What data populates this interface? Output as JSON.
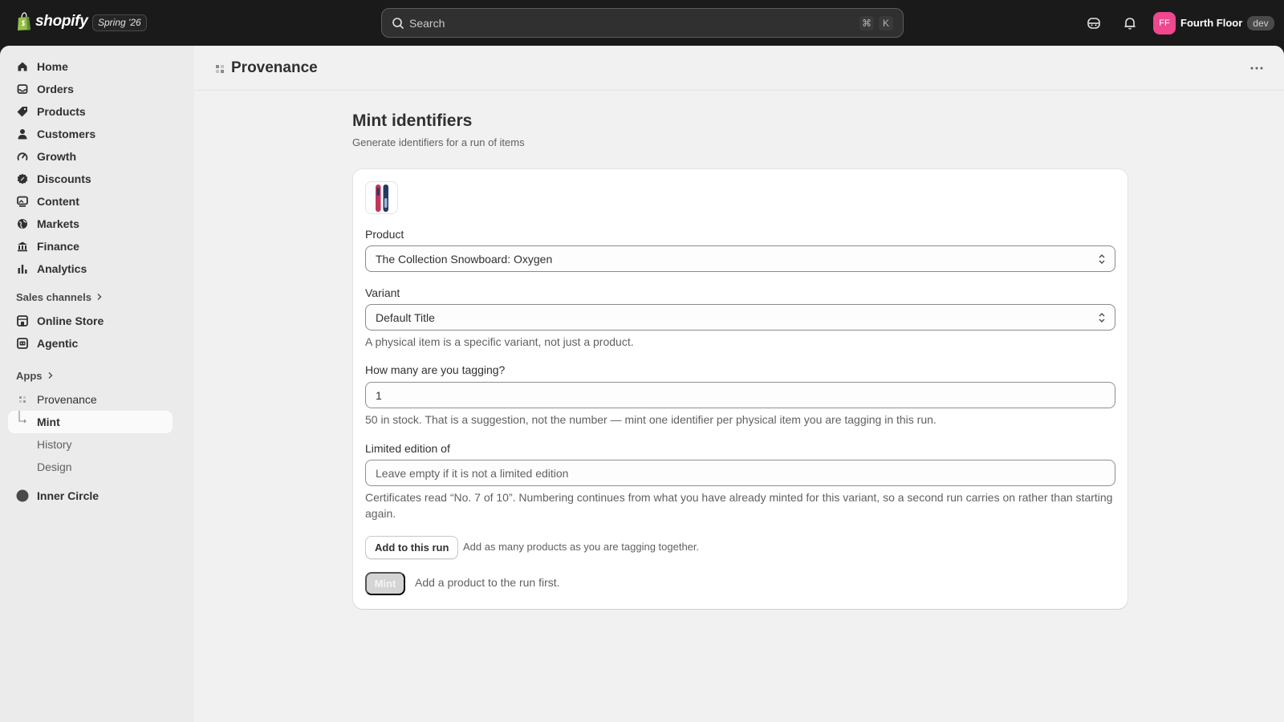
{
  "topbar": {
    "brand": "shopify",
    "release": "Spring '26",
    "search_placeholder": "Search",
    "shortcut_cmd": "⌘",
    "shortcut_key": "K",
    "store_initials": "FF",
    "store_name": "Fourth Floor",
    "store_env": "dev"
  },
  "sidebar": {
    "items": [
      {
        "label": "Home",
        "icon": "home-icon"
      },
      {
        "label": "Orders",
        "icon": "inbox-icon"
      },
      {
        "label": "Products",
        "icon": "tag-icon"
      },
      {
        "label": "Customers",
        "icon": "person-icon"
      },
      {
        "label": "Growth",
        "icon": "gauge-icon"
      },
      {
        "label": "Discounts",
        "icon": "discount-icon"
      },
      {
        "label": "Content",
        "icon": "image-icon"
      },
      {
        "label": "Markets",
        "icon": "globe-icon"
      },
      {
        "label": "Finance",
        "icon": "bank-icon"
      },
      {
        "label": "Analytics",
        "icon": "bar-chart-icon"
      }
    ],
    "sales_channels_label": "Sales channels",
    "sales_channels": [
      {
        "label": "Online Store",
        "icon": "store-icon"
      },
      {
        "label": "Agentic",
        "icon": "robot-icon"
      }
    ],
    "apps_label": "Apps",
    "apps": {
      "app_label": "Provenance",
      "sub_items": [
        "Mint",
        "History",
        "Design"
      ],
      "active": "Mint"
    },
    "other": {
      "label": "Inner Circle"
    }
  },
  "page": {
    "app_title": "Provenance",
    "heading": "Mint identifiers",
    "subheading": "Generate identifiers for a run of items"
  },
  "form": {
    "product_label": "Product",
    "product_value": "The Collection Snowboard: Oxygen",
    "variant_label": "Variant",
    "variant_value": "Default Title",
    "variant_help": "A physical item is a specific variant, not just a product.",
    "quantity_label": "How many are you tagging?",
    "quantity_value": "1",
    "quantity_help": "50 in stock. That is a suggestion, not the number — mint one identifier per physical item you are tagging in this run.",
    "edition_label": "Limited edition of",
    "edition_placeholder": "Leave empty if it is not a limited edition",
    "edition_help": "Certificates read “No. 7 of 10”. Numbering continues from what you have already minted for this variant, so a second run carries on rather than starting again.",
    "add_button": "Add to this run",
    "add_help": "Add as many products as you are tagging together.",
    "mint_button": "Mint",
    "mint_help": "Add a product to the run first."
  },
  "colors": {
    "topbar": "#1a1a1a",
    "avatar": "#f0478f",
    "frame": "#ebebeb",
    "main": "#f1f1f1",
    "card": "#ffffff"
  }
}
